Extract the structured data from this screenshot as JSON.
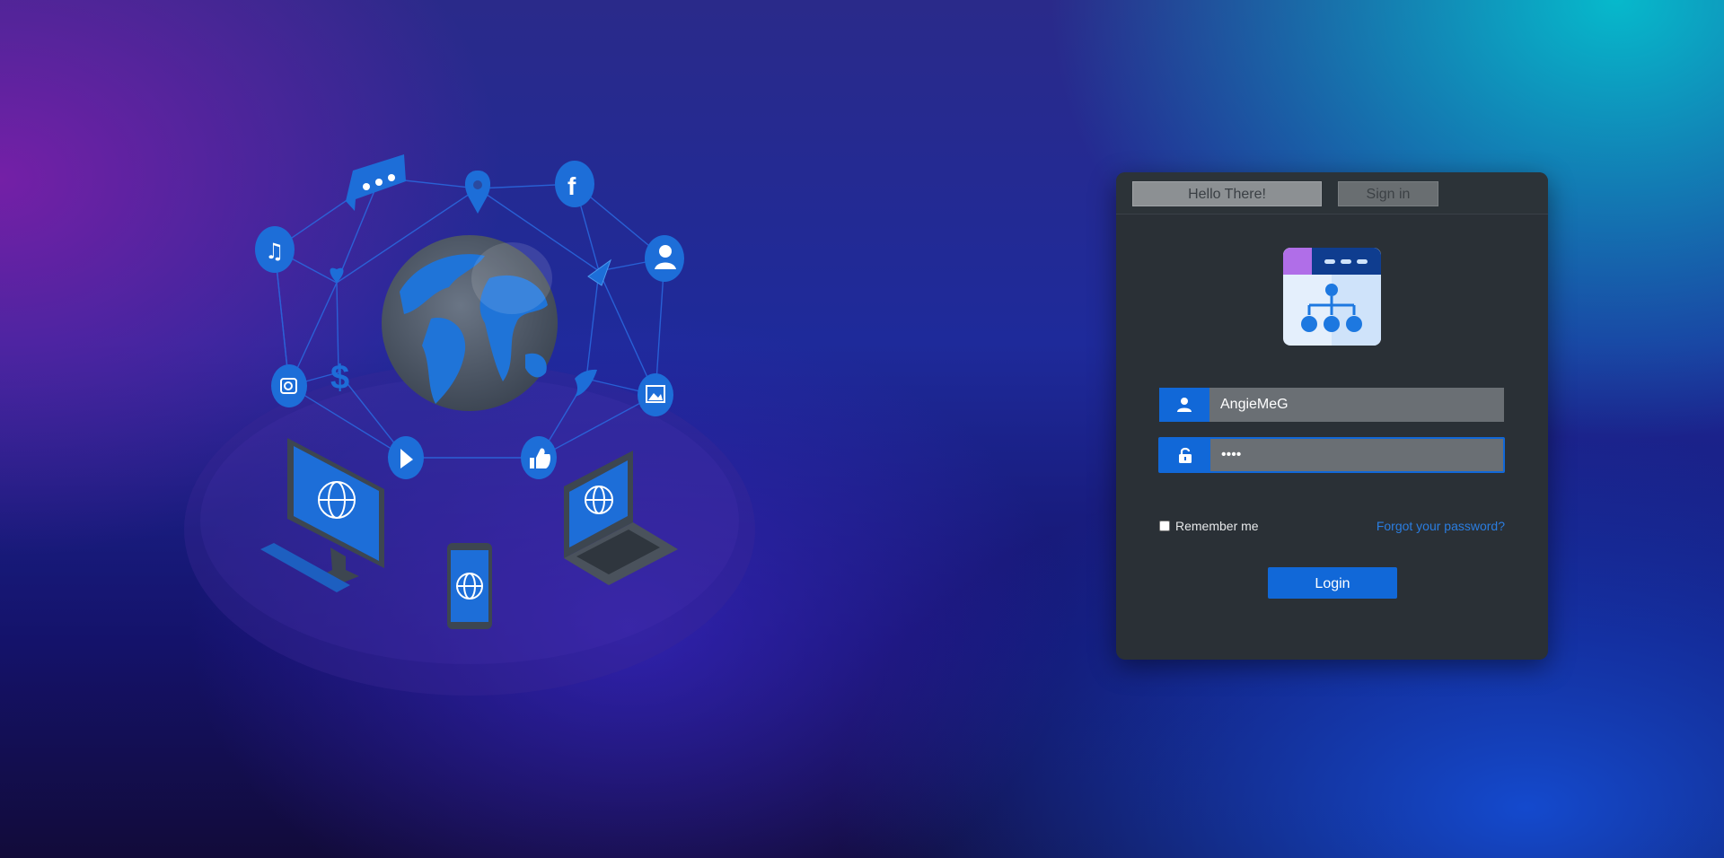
{
  "tabs": {
    "hello": "Hello There!",
    "signin": "Sign in"
  },
  "form": {
    "username_value": "AngieMeG",
    "password_value": "••••",
    "remember_label": "Remember me",
    "forgot_label": "Forgot your password?",
    "login_label": "Login"
  },
  "icons": {
    "user": "user-icon",
    "lock": "unlock-icon",
    "logo": "sitemap-window-icon"
  },
  "colors": {
    "accent": "#1168d8",
    "card_bg": "#2a3036",
    "input_bg": "#6a6f74",
    "link": "#2a7de0"
  }
}
